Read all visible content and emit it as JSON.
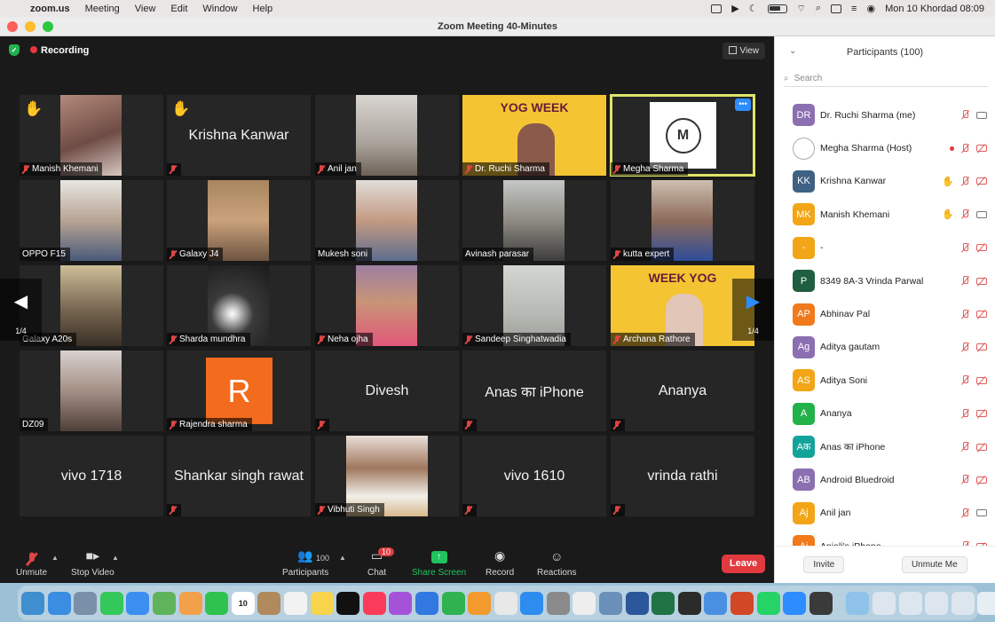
{
  "menubar": {
    "app": "zoom.us",
    "items": [
      "Meeting",
      "View",
      "Edit",
      "Window",
      "Help"
    ],
    "datetime": "Mon 10 Khordad  08:09"
  },
  "window": {
    "title": "Zoom Meeting   40-Minutes"
  },
  "meeting": {
    "recording_label": "Recording",
    "view_label": "View",
    "page_left": "1/4",
    "page_right": "1/4"
  },
  "tiles": {
    "t1": "Manish Khemani",
    "t2": "Krishna Kanwar",
    "t3": "Anil jan",
    "t4": "Dr. Ruchi Sharma",
    "t4_banner": "YOG  WEEK",
    "t5": "Megha Sharma",
    "t6": "OPPO F15",
    "t7": "Galaxy J4",
    "t8": "Mukesh soni",
    "t9": "Avinash parasar",
    "t10": "kutta expert",
    "t11": "Galaxy A20s",
    "t12": "Sharda mundhra",
    "t13": "Neha ojha",
    "t14": "Sandeep Singhatwadia",
    "t15": "Archana Rathore",
    "t15_banner": "WEEK  YOG",
    "t16": "DZ09",
    "t17": "Rajendra sharma",
    "t17_avatar": "R",
    "t18": "Divesh",
    "t19": "Anas का iPhone",
    "t20": "Ananya",
    "t21": "vivo 1718",
    "t22": "Shankar singh rawat",
    "t23": "Vibhuti Singh",
    "t24": "vivo 1610",
    "t25": "vrinda rathi"
  },
  "toolbar": {
    "unmute": "Unmute",
    "stop_video": "Stop Video",
    "participants": "Participants",
    "participants_count": "100",
    "chat": "Chat",
    "chat_badge": "10",
    "share_screen": "Share Screen",
    "record": "Record",
    "reactions": "Reactions",
    "leave": "Leave"
  },
  "panel": {
    "title": "Participants (100)",
    "search_placeholder": "Search",
    "invite": "Invite",
    "unmute_me": "Unmute Me",
    "participants": [
      {
        "initials": "DR",
        "name": "Dr. Ruchi Sharma (me)",
        "color": "#8b6fb0"
      },
      {
        "initials": "",
        "name": "Megha Sharma (Host)",
        "color": "#ffffff"
      },
      {
        "initials": "KK",
        "name": "Krishna Kanwar",
        "color": "#3f6183"
      },
      {
        "initials": "MK",
        "name": "Manish Khemani",
        "color": "#f2a516"
      },
      {
        "initials": "-",
        "name": "-",
        "color": "#f2a516"
      },
      {
        "initials": "P",
        "name": "8349 8A-3 Vrinda Parwal",
        "color": "#1f5e3f"
      },
      {
        "initials": "AP",
        "name": "Abhinav Pal",
        "color": "#f07a1c"
      },
      {
        "initials": "Ag",
        "name": "Aditya gautam",
        "color": "#8b6fb0"
      },
      {
        "initials": "AS",
        "name": "Aditya Soni",
        "color": "#f2a516"
      },
      {
        "initials": "A",
        "name": "Ananya",
        "color": "#23b24a"
      },
      {
        "initials": "Aक",
        "name": "Anas का iPhone",
        "color": "#14a39b"
      },
      {
        "initials": "AB",
        "name": "Android Bluedroid",
        "color": "#8b6fb0"
      },
      {
        "initials": "Aj",
        "name": "Anil jan",
        "color": "#f2a516"
      },
      {
        "initials": "Ai",
        "name": "Anjali's iPhone",
        "color": "#f07a1c"
      }
    ]
  },
  "dock": {
    "calendar_day": "10"
  }
}
